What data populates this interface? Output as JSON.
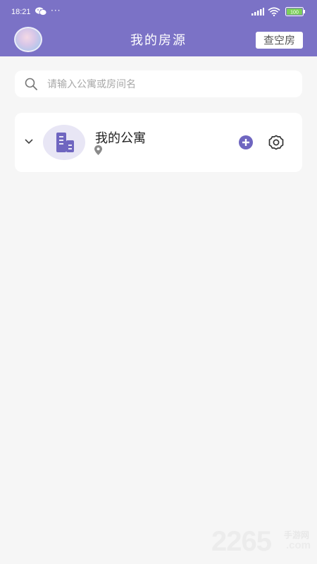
{
  "status_bar": {
    "time": "18:21",
    "more": "···",
    "battery": "100"
  },
  "header": {
    "title": "我的房源",
    "vacant_button": "查空房",
    "background": "#7b72c6"
  },
  "search": {
    "placeholder": "请输入公寓或房间名",
    "icon": "search-icon"
  },
  "apartments": [
    {
      "name": "我的公寓",
      "address": "",
      "icon": "building-icon",
      "actions": [
        "add-icon",
        "gear-icon"
      ]
    }
  ],
  "watermark": {
    "number": "2265",
    "cn": "手游网",
    "com": ".com"
  },
  "colors": {
    "accent": "#7b72c6",
    "page_bg": "#f6f6f6"
  }
}
